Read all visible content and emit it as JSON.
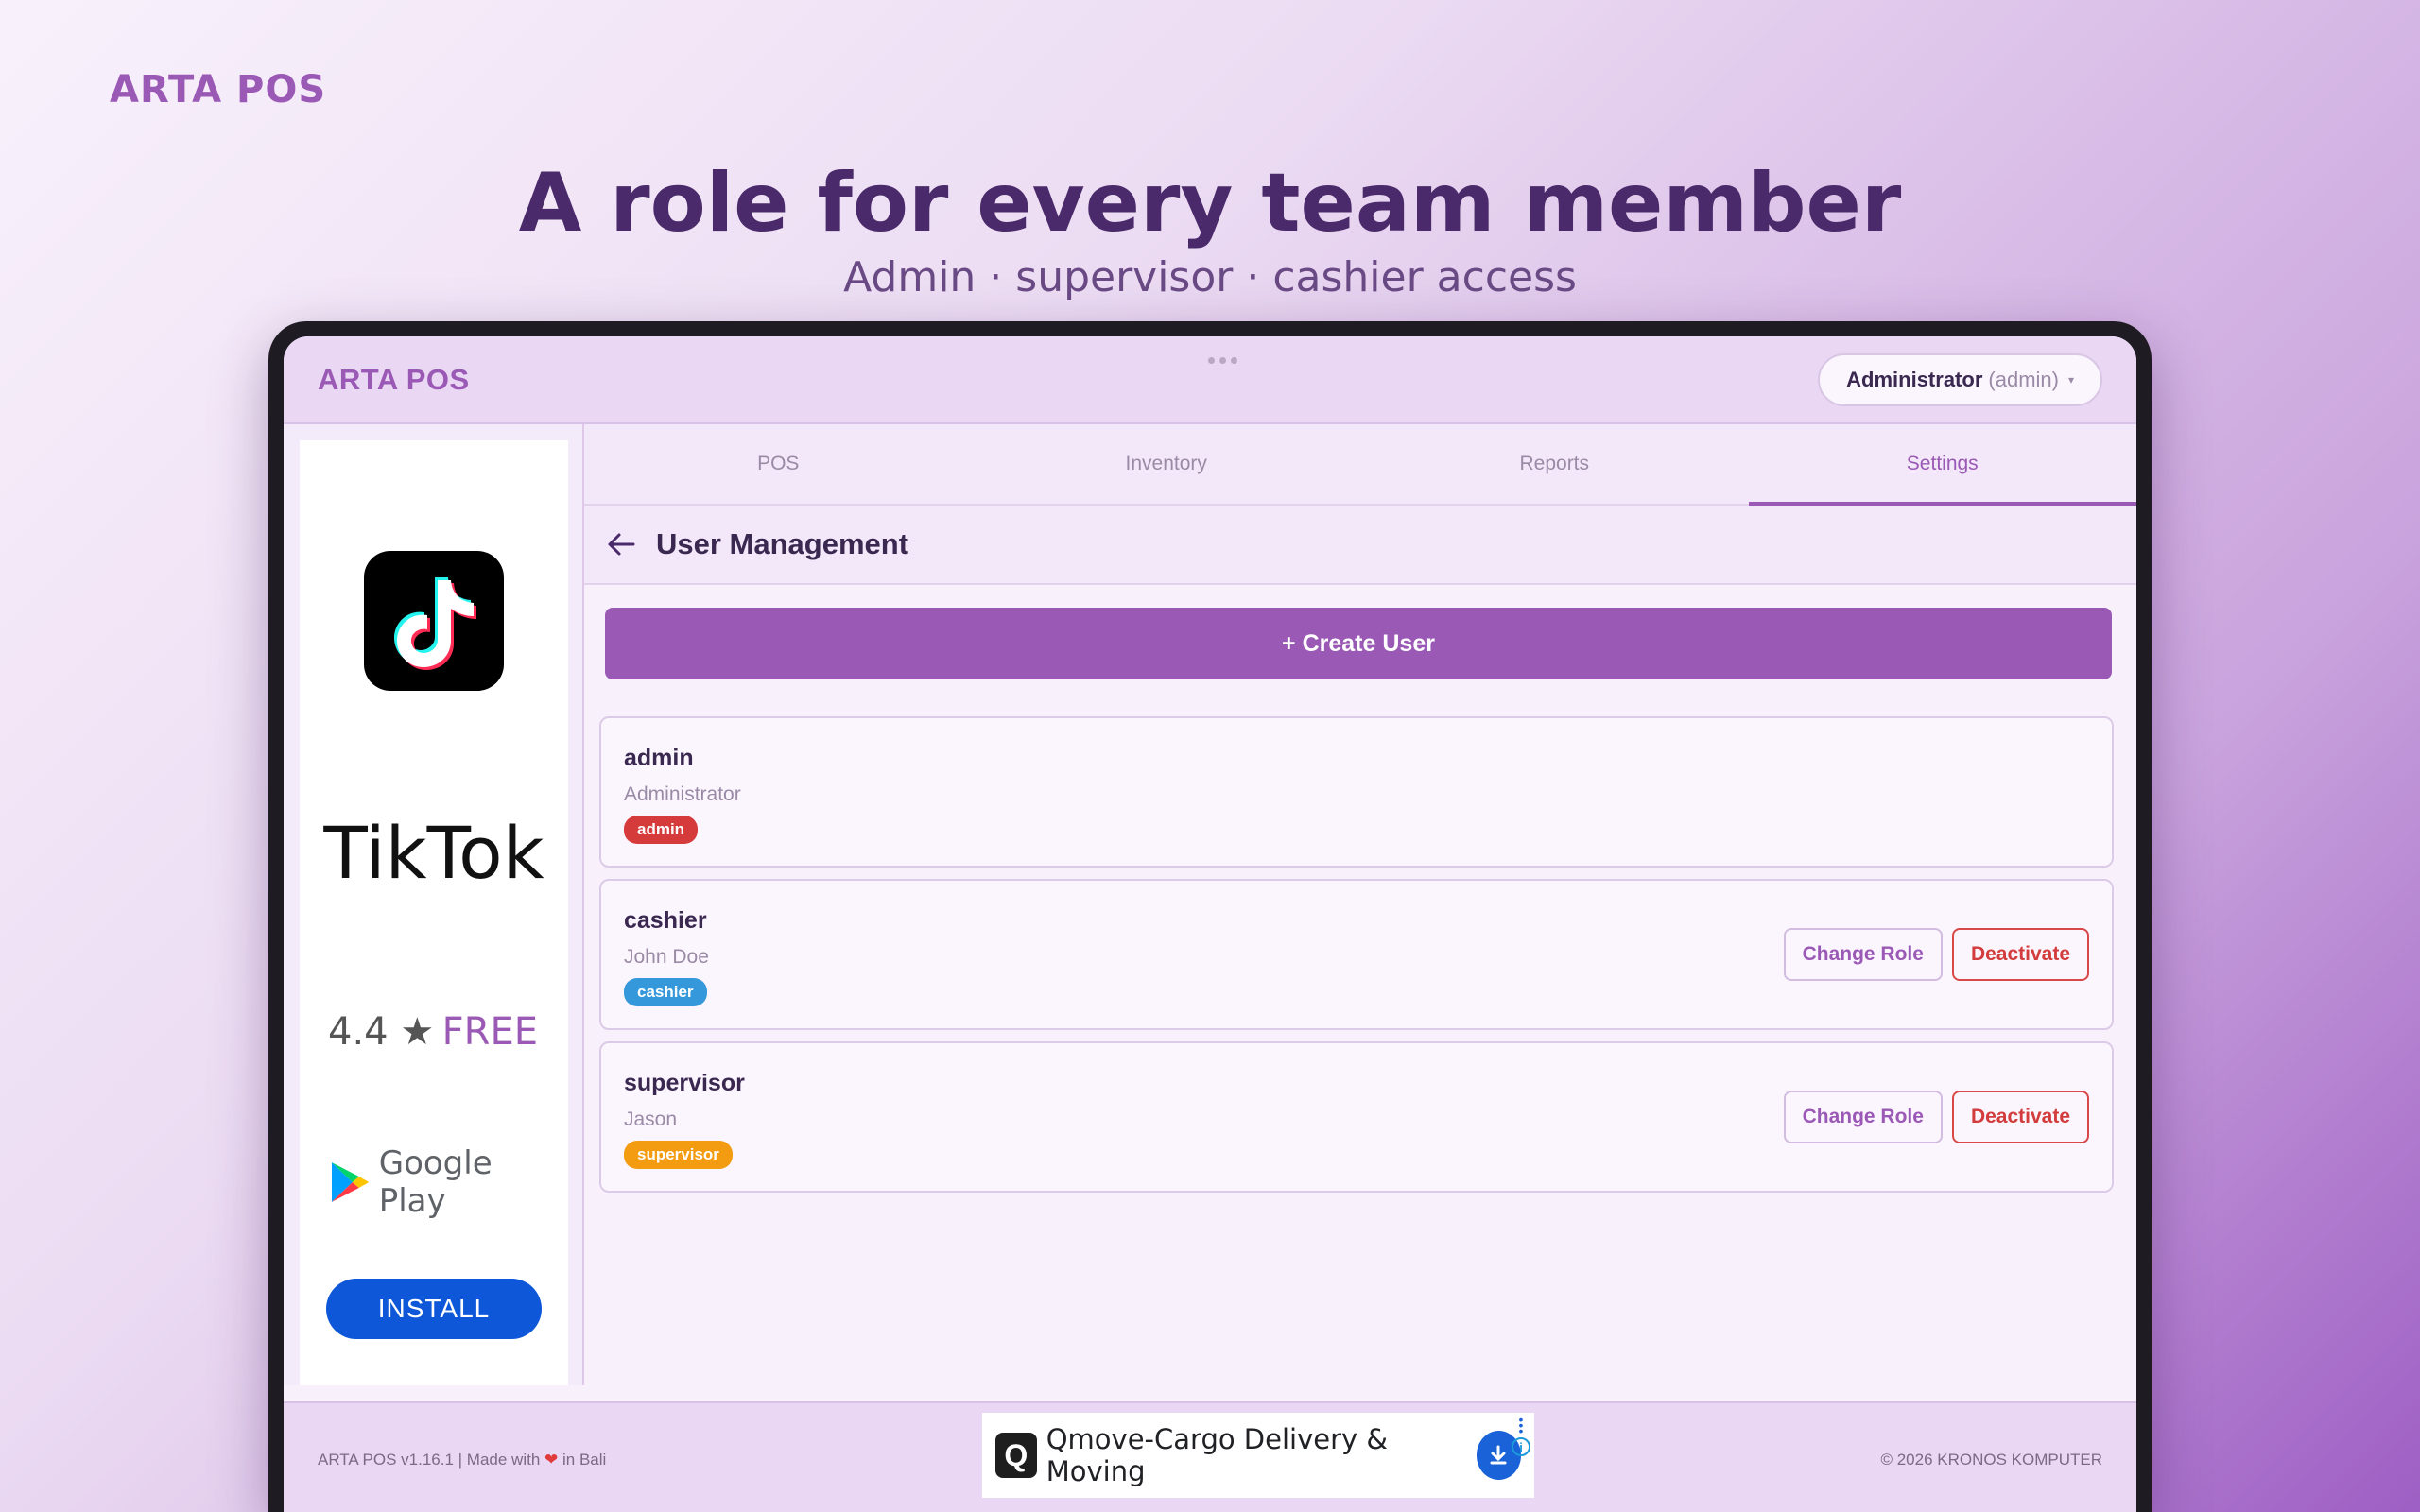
{
  "hero": {
    "brand": "ARTA POS",
    "title": "A role for every team member",
    "subtitle": "Admin · supervisor · cashier access"
  },
  "appbar": {
    "brand": "ARTA POS",
    "user_name": "Administrator",
    "user_role": "(admin)",
    "caret": "▾"
  },
  "tabs": [
    {
      "label": "POS"
    },
    {
      "label": "Inventory"
    },
    {
      "label": "Reports"
    },
    {
      "label": "Settings",
      "active": true
    }
  ],
  "page": {
    "title": "User Management",
    "create_label": "+ Create User"
  },
  "users": [
    {
      "username": "admin",
      "fullname": "Administrator",
      "role": "admin",
      "badge_color": "#d63b3b",
      "actions": false
    },
    {
      "username": "cashier",
      "fullname": "John Doe",
      "role": "cashier",
      "badge_color": "#3498db",
      "actions": true
    },
    {
      "username": "supervisor",
      "fullname": "Jason",
      "role": "supervisor",
      "badge_color": "#f39c12",
      "actions": true
    }
  ],
  "actions": {
    "change_role": "Change Role",
    "deactivate": "Deactivate"
  },
  "side_ad": {
    "app_name": "TikTok",
    "rating": "4.4 ★",
    "price": "FREE",
    "store": "Google Play",
    "install": "INSTALL"
  },
  "footer": {
    "left_prefix": "ARTA POS v1.16.1 | Made with",
    "heart": "❤",
    "left_suffix": "in Bali",
    "right": "© 2026 KRONOS KOMPUTER"
  },
  "banner_ad": {
    "logo_letter": "Q",
    "text": "Qmove-Cargo Delivery & Moving",
    "info": "i"
  },
  "colors": {
    "accent": "#9b59b6",
    "danger": "#d23c3c"
  }
}
